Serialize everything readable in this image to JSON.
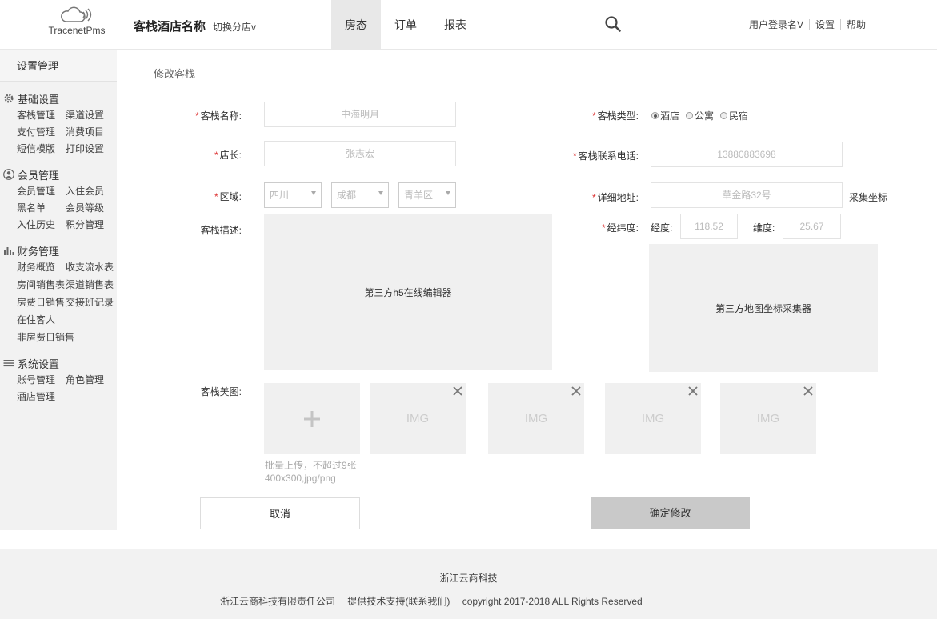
{
  "header": {
    "logo_text": "TracenetPms",
    "hotel_name": "客栈酒店名称",
    "switch_store": "切换分店v",
    "nav": [
      {
        "label": "房态",
        "active": true
      },
      {
        "label": "订单",
        "active": false
      },
      {
        "label": "报表",
        "active": false
      }
    ],
    "search_icon": "search-icon",
    "user_links": [
      "用户登录名V",
      "设置",
      "帮助"
    ]
  },
  "sidebar": {
    "title": "设置管理",
    "groups": [
      {
        "title": "基础设置",
        "icon": "gear-icon",
        "items": [
          "客栈管理",
          "渠道设置",
          "支付管理",
          "消费项目",
          "短信模版",
          "打印设置"
        ]
      },
      {
        "title": "会员管理",
        "icon": "user-icon",
        "items": [
          "会员管理",
          "入住会员",
          "黑名单",
          "会员等级",
          "入住历史",
          "积分管理"
        ]
      },
      {
        "title": "财务管理",
        "icon": "bar-chart-icon",
        "items": [
          "财务概览",
          "收支流水表",
          "房间销售表",
          "渠道销售表",
          "房费日销售",
          "交接班记录",
          "在住客人",
          "非房费日销售"
        ]
      },
      {
        "title": "系统设置",
        "icon": "menu-icon",
        "items": [
          "账号管理",
          "角色管理",
          "酒店管理"
        ]
      }
    ]
  },
  "main": {
    "title": "修改客栈",
    "form": {
      "name_label": "客栈名称:",
      "name_value": "中海明月",
      "type_label": "客栈类型:",
      "type_options": [
        {
          "label": "酒店",
          "checked": true
        },
        {
          "label": "公寓",
          "checked": false
        },
        {
          "label": "民宿",
          "checked": false
        }
      ],
      "manager_label": "店长:",
      "manager_value": "张志宏",
      "phone_label": "客栈联系电话:",
      "phone_value": "13880883698",
      "region_label": "区域:",
      "region_province": "四川",
      "region_city": "成都",
      "region_district": "青羊区",
      "address_label": "详细地址:",
      "address_value": "草金路32号",
      "collect_coord": "采集坐标",
      "desc_label": "客栈描述:",
      "editor_text": "第三方h5在线编辑器",
      "latlng_label": "经纬度:",
      "lng_label": "经度:",
      "lng_value": "118.52",
      "lat_label": "维度:",
      "lat_value": "25.67",
      "map_text": "第三方地图坐标采集器",
      "images_label": "客栈美图:",
      "upload_icon": "plus-icon",
      "image_tiles": [
        "IMG",
        "IMG",
        "IMG",
        "IMG"
      ],
      "upload_tip_line1": "批量上传，不超过9张",
      "upload_tip_line2": "400x300,jpg/png",
      "cancel_label": "取消",
      "confirm_label": "确定修改"
    }
  },
  "footer": {
    "company_short": "浙江云商科技",
    "company_full": "浙江云商科技有限责任公司",
    "support": "提供技术支持(联系我们)",
    "copyright": "copyright 2017-2018 ALL Rights Reserved"
  },
  "colors": {
    "nav_active_bg": "#e8e8e8",
    "sidebar_bg": "#f2f2f2",
    "required": "#dd3333",
    "confirm_bg": "#c9c9c9"
  }
}
